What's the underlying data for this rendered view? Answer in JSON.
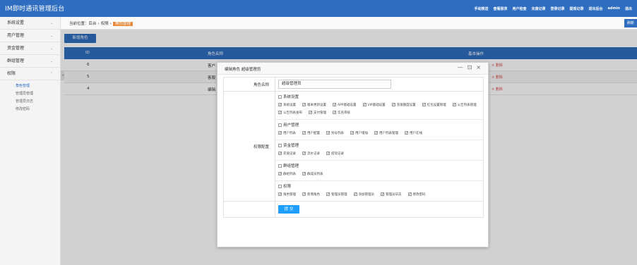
{
  "app": {
    "title": "IM即时通讯管理后台"
  },
  "topnav": [
    "手动推送",
    "查看报表",
    "用户检查",
    "充值记录",
    "登录记录",
    "提现记录",
    "退出后台",
    "admin",
    "退出"
  ],
  "sidebar": {
    "groups": [
      {
        "label": "系统设置",
        "chev": "⌄"
      },
      {
        "label": "用户管理",
        "chev": "⌄"
      },
      {
        "label": "资金管理",
        "chev": "⌄"
      },
      {
        "label": "群组管理",
        "chev": "⌄"
      },
      {
        "label": "权限",
        "chev": "⌃"
      }
    ],
    "subitems": [
      "角色管理",
      "管理员管理",
      "管理员日志",
      "修改密码"
    ],
    "collapse": "◂"
  },
  "breadcrumb": {
    "home": "当前位置：后台",
    "section": "权限",
    "current": "角色管理",
    "sep": "›"
  },
  "refresh_label": "刷新",
  "add_button": "新增角色",
  "grid": {
    "headers": [
      "ID",
      "角色名称",
      "基本操作"
    ],
    "rows": [
      {
        "id": "6",
        "name": "客户",
        "action": "× 删除"
      },
      {
        "id": "5",
        "name": "客服",
        "action": "× 删除"
      },
      {
        "id": "4",
        "name": "编辑",
        "action": "× 删除"
      }
    ]
  },
  "dialog": {
    "title": "编辑角色 超级管理员",
    "controls": {
      "minimize": "—",
      "maximize": "⊡",
      "close": "×"
    },
    "name_label": "角色名称",
    "name_value": "超级管理员",
    "perm_label": "权限配置",
    "groups": [
      {
        "name": "系统设置",
        "children": [
          "系统设置",
          "版本更新设置",
          "APP基础设置",
          "VIP基础设置",
          "充值额度设置",
          "红包设置管理",
          "公告列表管理",
          "公告列表发布",
          "支付管理",
          "实名审核"
        ]
      },
      {
        "name": "用户管理",
        "children": [
          "用户列表",
          "用户配置",
          "封号列表",
          "用户增加",
          "用户列表管理",
          "用户在线"
        ]
      },
      {
        "name": "资金管理",
        "children": [
          "充值记录",
          "流水记录",
          "提现记录"
        ]
      },
      {
        "name": "群组管理",
        "children": [
          "群组列表",
          "群成员列表"
        ]
      },
      {
        "name": "权限",
        "children": [
          "角色管理",
          "新增角色",
          "管理员管理",
          "添加管理员",
          "管理员日志",
          "修改密码"
        ]
      }
    ],
    "submit": "提 交"
  }
}
